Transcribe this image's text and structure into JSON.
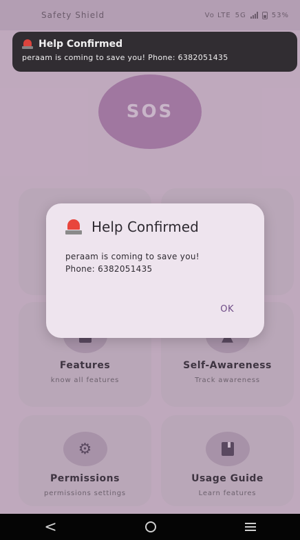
{
  "status_bar": {
    "app_name": "Safety Shield",
    "network_small": "Vo LTE",
    "network": "5G",
    "battery": "53%"
  },
  "toast": {
    "icon": "siren-icon",
    "title": "Help Confirmed",
    "body": "peraam is coming to save you! Phone: 6382051435"
  },
  "sos": {
    "label": "SOS"
  },
  "cards": [
    {
      "title": "Features",
      "subtitle": "know all features",
      "icon": "book-icon"
    },
    {
      "title": "Self-Awareness",
      "subtitle": "Track awareness",
      "icon": "shield-icon"
    },
    {
      "title": "Permissions",
      "subtitle": "permissions settings",
      "icon": "gear-icon"
    },
    {
      "title": "Usage Guide",
      "subtitle": "Learn features",
      "icon": "book-icon"
    }
  ],
  "dialog": {
    "icon": "siren-icon",
    "title": "Help Confirmed",
    "line1": "peraam is coming to save you!",
    "line2": "Phone: 6382051435",
    "ok_label": "OK"
  },
  "nav": {
    "back": "<",
    "home": "home-icon",
    "menu": "menu-icon"
  },
  "colors": {
    "background": "#c9b2c7",
    "sos": "#a87ca8",
    "dialog": "#eee4ee",
    "accent": "#6e4b86",
    "toast": "#2f2c30"
  }
}
